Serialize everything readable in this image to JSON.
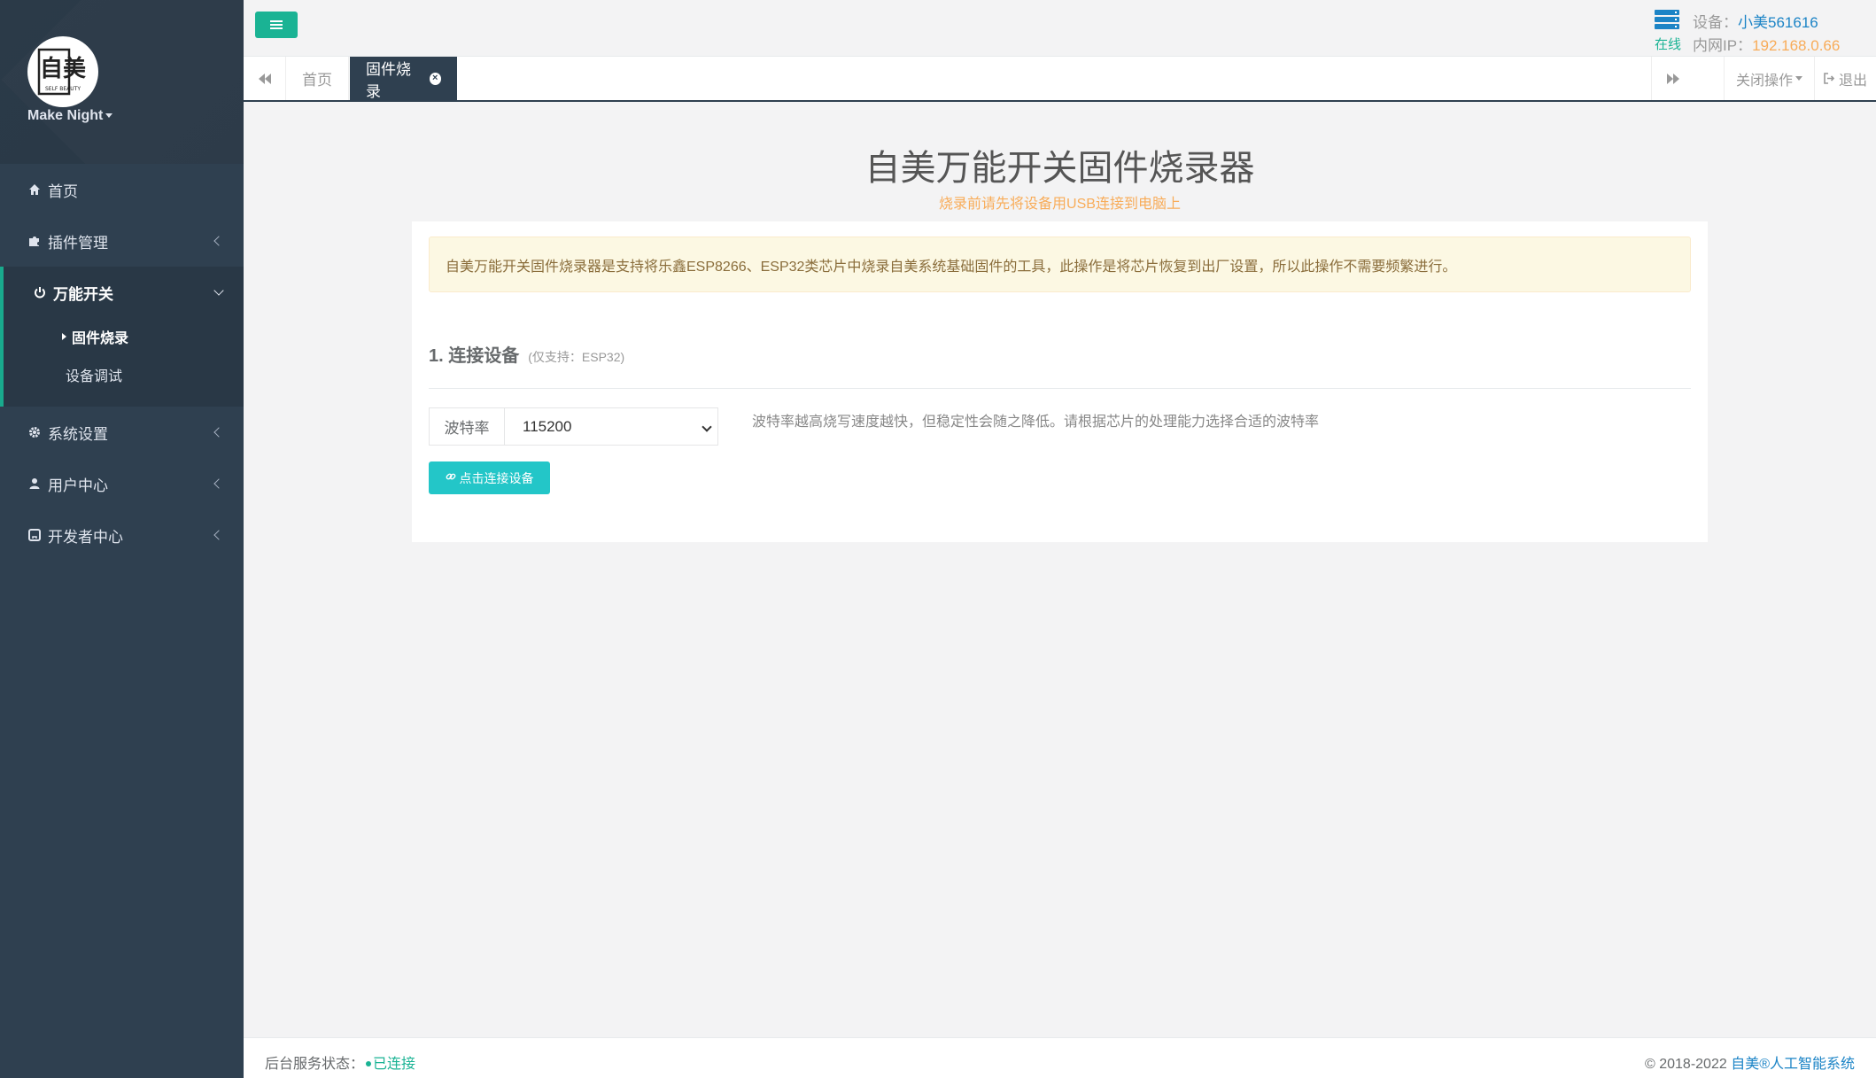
{
  "sidebar": {
    "profile_name": "Make Night",
    "logo_text": "自美",
    "logo_subtext": "SELF BEAUTY",
    "items": [
      {
        "label": "首页",
        "icon": "home-icon"
      },
      {
        "label": "插件管理",
        "icon": "puzzle-icon"
      },
      {
        "label": "万能开关",
        "icon": "power-icon",
        "expanded": true,
        "children": [
          {
            "label": "固件烧录",
            "active": true
          },
          {
            "label": "设备调试"
          }
        ]
      },
      {
        "label": "系统设置",
        "icon": "gear-icon"
      },
      {
        "label": "用户中心",
        "icon": "user-icon"
      },
      {
        "label": "开发者中心",
        "icon": "github-icon"
      }
    ]
  },
  "header": {
    "device_label": "设备：",
    "device_name": "小美561616",
    "online": "在线",
    "ip_label": "内网IP：",
    "ip_value": "192.168.0.66"
  },
  "tabs": {
    "home": "首页",
    "firmware": "固件烧录",
    "close_ops": "关闭操作",
    "logout": "退出"
  },
  "main": {
    "title": "自美万能开关固件烧录器",
    "subtitle": "烧录前请先将设备用USB连接到电脑上",
    "alert": "自美万能开关固件烧录器是支持将乐鑫ESP8266、ESP32类芯片中烧录自美系统基础固件的工具，此操作是将芯片恢复到出厂设置，所以此操作不需要频繁进行。",
    "section_title": "1. 连接设备",
    "section_note": "(仅支持：ESP32)",
    "baud_label": "波特率",
    "baud_value": "115200",
    "baud_help": "波特率越高烧写速度越快，但稳定性会随之降低。请根据芯片的处理能力选择合适的波特率",
    "connect_button": "点击连接设备"
  },
  "footer": {
    "status_label": "后台服务状态：",
    "status_value": "已连接",
    "copyright": "© 2018-2022",
    "company": "自美®人工智能系统"
  },
  "colors": {
    "sidebar": "#2f4050",
    "primary": "#1ab394",
    "info": "#23c6c8",
    "link": "#1c84c6",
    "warning": "#f8ac59"
  }
}
